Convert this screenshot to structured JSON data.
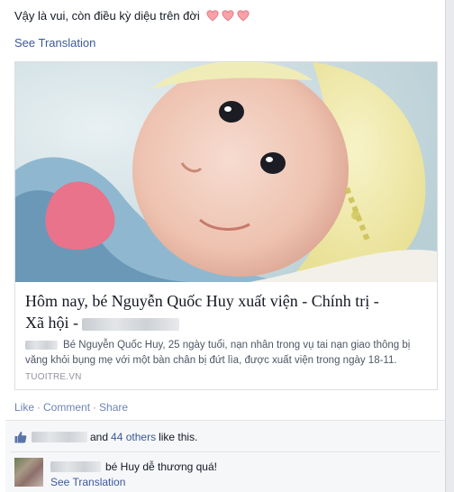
{
  "post": {
    "status_text": "Vậy là vui, còn điều kỳ diệu trên đời",
    "hearts": [
      "heart-icon",
      "heart-icon",
      "heart-icon"
    ],
    "see_translation": "See Translation"
  },
  "link_card": {
    "image": "photo-of-newborn-baby-in-yellow-knit-hat",
    "title_line1": "Hôm nay, bé Nguyễn Quốc Huy xuất viện - Chính trị -",
    "title_line2": "Xã hội -",
    "description": "Bé Nguyễn Quốc Huy, 25 ngày tuổi, nạn nhân trong vụ tai nạn giao thông bị văng khỏi bụng mẹ với một bàn chân bị đứt lìa, được xuất viện trong ngày 18-11.",
    "source": "TUOITRE.VN"
  },
  "actions": {
    "like": "Like",
    "comment": "Comment",
    "share": "Share",
    "separator": "·"
  },
  "likes": {
    "prefix": "and",
    "others_link": "44 others",
    "suffix": "like this."
  },
  "comment": {
    "text": "bé Huy dễ thương quá!",
    "see_translation": "See Translation"
  },
  "colors": {
    "link": "#3b5998",
    "heart": "#f7a1a8",
    "feedback_bg": "#f6f7f9"
  }
}
